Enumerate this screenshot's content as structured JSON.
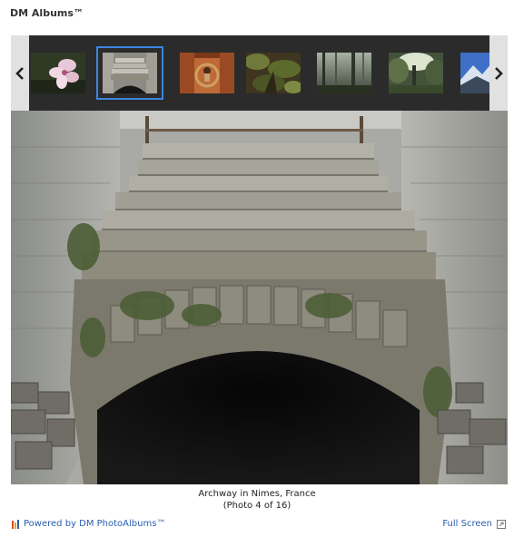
{
  "app": {
    "title": "DM Albums™"
  },
  "filmstrip": {
    "prev_icon": "chevron-left-icon",
    "next_icon": "chevron-right-icon",
    "thumbnails": [
      {
        "subject": "pink flower"
      },
      {
        "subject": "stone stairs",
        "selected": true
      },
      {
        "subject": "bronze door knocker"
      },
      {
        "subject": "forest ferns"
      },
      {
        "subject": "misty forest"
      },
      {
        "subject": "sunlit trees"
      },
      {
        "subject": "blue mountains"
      }
    ]
  },
  "photo": {
    "title": "Archway in Nimes, France",
    "counter": "(Photo 4 of 16)"
  },
  "footer": {
    "powered_by": "Powered by DM PhotoAlbums™",
    "fullscreen_label": "Full Screen",
    "fullscreen_icon": "expand-icon"
  },
  "colors": {
    "filmstrip_bg": "#2b2b2b",
    "selected_border": "#3b86e0",
    "link": "#2a5db0"
  }
}
